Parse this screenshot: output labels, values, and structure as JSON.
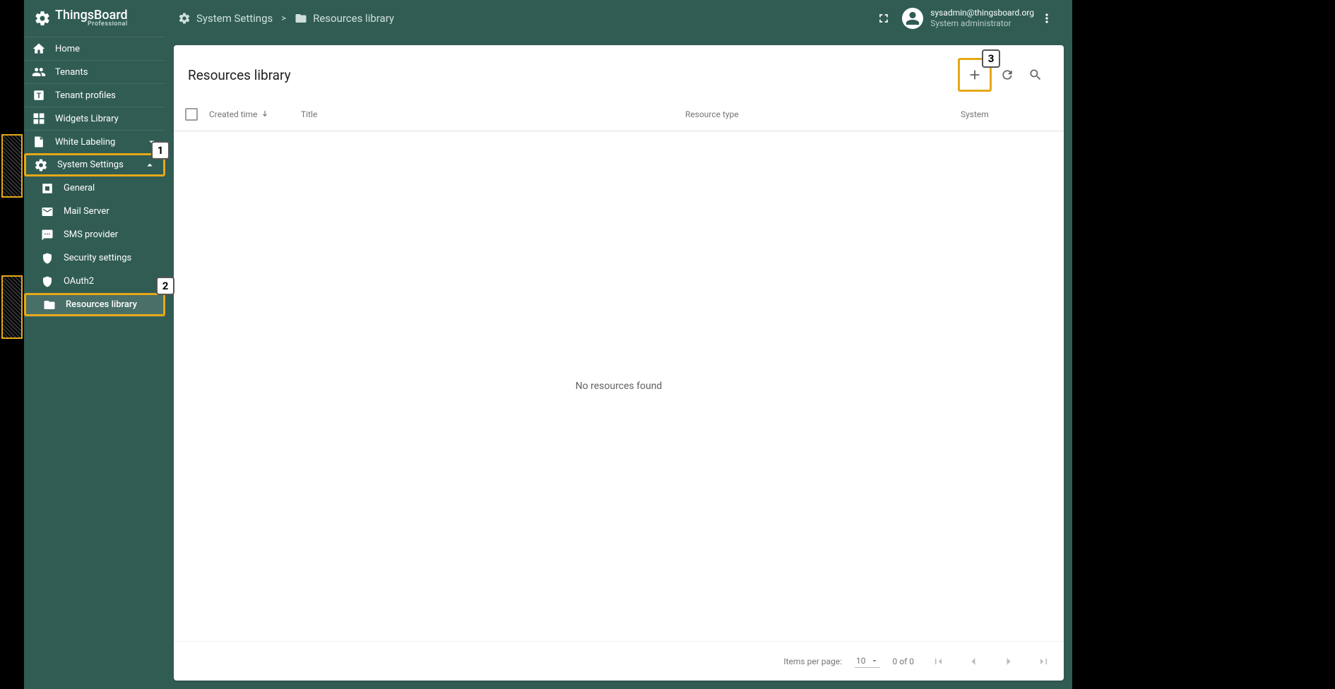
{
  "app_name": "ThingsBoard",
  "app_tagline": "Professional",
  "breadcrumbs": {
    "seg1_icon": "gear-icon",
    "seg1_label": "System Settings",
    "seg2_icon": "folder-icon",
    "seg2_label": "Resources library"
  },
  "user": {
    "email": "sysadmin@thingsboard.org",
    "role": "System administrator"
  },
  "sidebar": {
    "items": [
      {
        "icon": "home",
        "label": "Home"
      },
      {
        "icon": "group",
        "label": "Tenants"
      },
      {
        "icon": "tprof",
        "label": "Tenant profiles"
      },
      {
        "icon": "widgets",
        "label": "Widgets Library"
      },
      {
        "icon": "label",
        "label": "White Labeling",
        "expandable": true,
        "expanded": false
      },
      {
        "icon": "gear",
        "label": "System Settings",
        "expandable": true,
        "expanded": true,
        "highlight": 1
      }
    ],
    "system_settings_children": [
      {
        "icon": "build",
        "label": "General"
      },
      {
        "icon": "mail",
        "label": "Mail Server"
      },
      {
        "icon": "sms",
        "label": "SMS provider"
      },
      {
        "icon": "security",
        "label": "Security settings"
      },
      {
        "icon": "security",
        "label": "OAuth2"
      },
      {
        "icon": "folder",
        "label": "Resources library",
        "active": true,
        "highlight": 2
      }
    ]
  },
  "page_title": "Resources library",
  "add_highlight": 3,
  "table": {
    "columns": {
      "created": "Created time",
      "title": "Title",
      "type": "Resource type",
      "system": "System"
    },
    "empty_message": "No resources found"
  },
  "paginator": {
    "label": "Items per page:",
    "page_size": "10",
    "range": "0 of 0"
  }
}
